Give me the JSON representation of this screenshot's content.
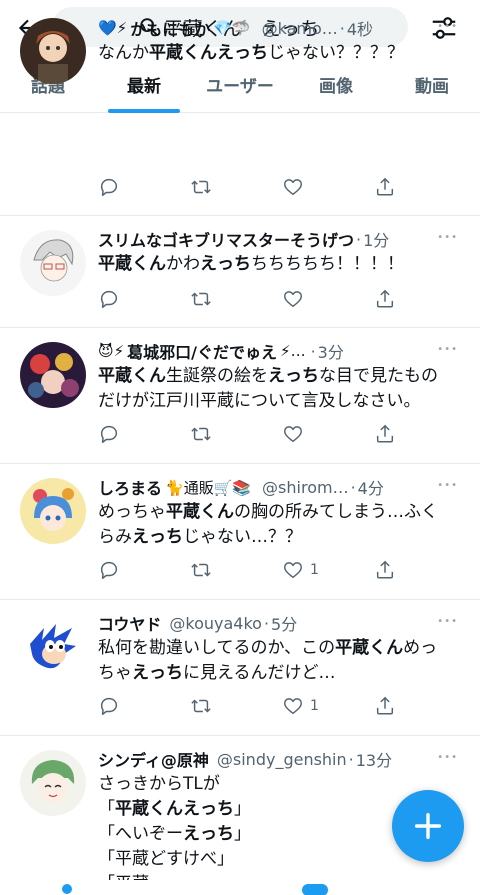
{
  "search": {
    "query": "平蔵くん　えっち"
  },
  "tabs": [
    "話題",
    "最新",
    "ユーザー",
    "画像",
    "動画"
  ],
  "active_tab": 1,
  "colors": {
    "accent": "#1d9bf0",
    "muted": "#536471"
  },
  "icons": {
    "back": "arrow-left-icon",
    "search": "magnifier-icon",
    "filter": "sliders-icon",
    "reply": "reply-icon",
    "retweet": "retweet-icon",
    "like": "heart-icon",
    "share": "share-icon",
    "more": "ellipsis-icon",
    "compose": "plus-icon"
  },
  "tweets": [
    {
      "name_prefix": "💙⚡",
      "name": "かもにもか",
      "name_suffix": "💎🦈",
      "handle": "@kamo…",
      "time": "4秒",
      "lines": [
        [
          [
            "なんか",
            0
          ],
          [
            "平蔵くんえっち",
            1
          ],
          [
            "じゃない？？？？",
            0
          ]
        ]
      ],
      "like_count": ""
    },
    {
      "name_prefix": "",
      "name": "スリムなゴキブリマスターそうげつ",
      "name_suffix": "",
      "handle": "",
      "time": "1分",
      "lines": [
        [
          [
            "平蔵くん",
            1
          ],
          [
            "かわ",
            0
          ],
          [
            "えっち",
            1
          ],
          [
            "ちちちちち！！！！",
            0
          ]
        ]
      ],
      "like_count": ""
    },
    {
      "name_prefix": "😈⚡",
      "name": "葛城邪口/ぐだでゅえ",
      "name_suffix": "⚡…",
      "handle": "",
      "time": "3分",
      "lines": [
        [
          [
            "平蔵くん",
            1
          ],
          [
            "生誕祭の絵を",
            0
          ],
          [
            "えっち",
            1
          ],
          [
            "な目で見たもの",
            0
          ]
        ],
        [
          [
            "だけが江戸川平蔵について言及しなさい。",
            0
          ]
        ]
      ],
      "like_count": ""
    },
    {
      "name_prefix": "",
      "name": "しろまる",
      "name_suffix": "🐈通販🛒📚",
      "handle": "@shirom…",
      "time": "4分",
      "lines": [
        [
          [
            "めっちゃ",
            0
          ],
          [
            "平蔵くん",
            1
          ],
          [
            "の胸の所みてしまう…ふく",
            0
          ]
        ],
        [
          [
            "らみ",
            0
          ],
          [
            "えっち",
            1
          ],
          [
            "じゃない…？？",
            0
          ]
        ]
      ],
      "like_count": "1"
    },
    {
      "name_prefix": "",
      "name": "コウヤド",
      "name_suffix": "",
      "handle": "@kouya4ko",
      "time": "5分",
      "lines": [
        [
          [
            "私何を勘違いしてるのか、この",
            0
          ],
          [
            "平蔵くん",
            1
          ],
          [
            "めっ",
            0
          ]
        ],
        [
          [
            "ちゃ",
            0
          ],
          [
            "えっち",
            1
          ],
          [
            "に見えるんだけど…",
            0
          ]
        ]
      ],
      "like_count": "1"
    },
    {
      "name_prefix": "",
      "name": "シンディ@原神",
      "name_suffix": "",
      "handle": "@sindy_genshin",
      "time": "13分",
      "lines": [
        [
          [
            "さっきからTLが",
            0
          ]
        ],
        [
          [
            "「",
            0
          ],
          [
            "平蔵くんえっち",
            1
          ],
          [
            "」",
            0
          ]
        ],
        [
          [
            "「へいぞー",
            0
          ],
          [
            "えっち",
            1
          ],
          [
            "」",
            0
          ]
        ],
        [
          [
            "「平蔵どすけべ」",
            0
          ]
        ],
        [
          [
            "「平蔵…",
            0
          ]
        ]
      ],
      "like_count": ""
    }
  ]
}
